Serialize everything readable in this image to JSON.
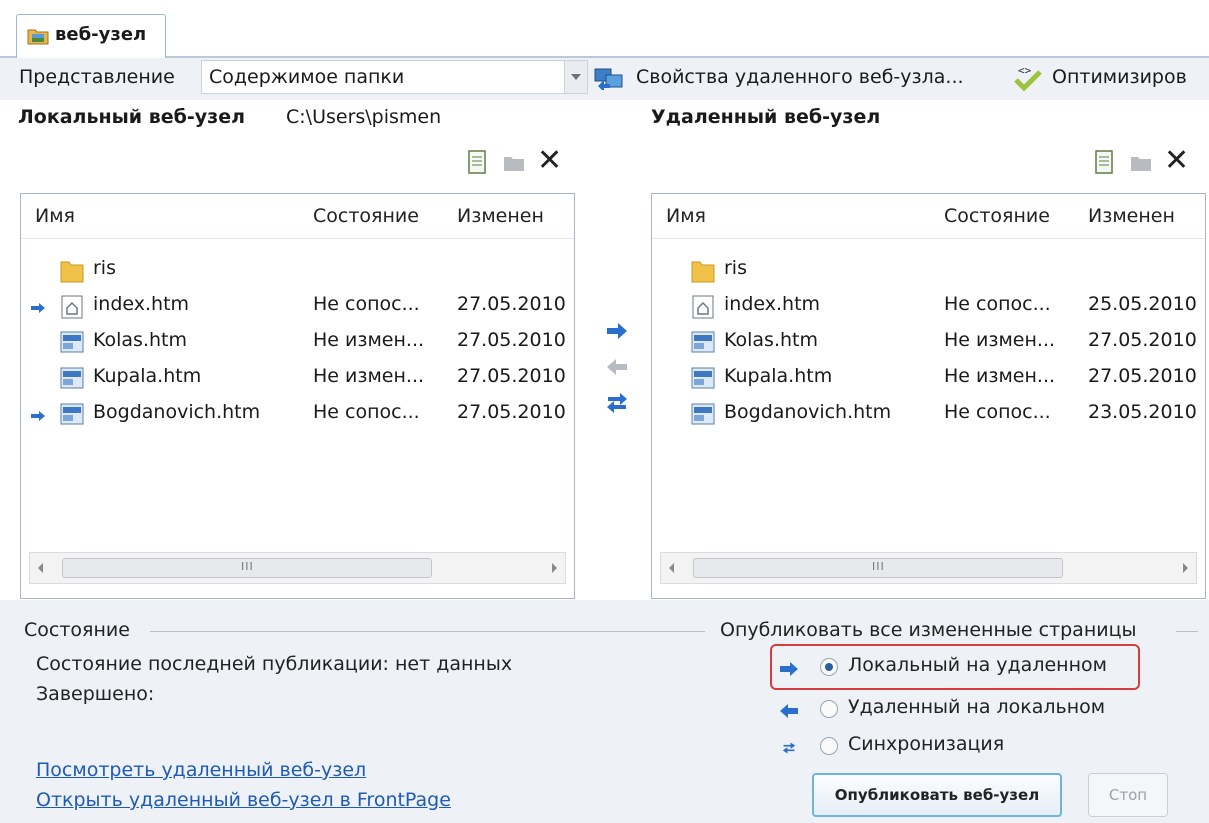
{
  "tab": {
    "label": "веб-узел",
    "icon": "site-folder-icon"
  },
  "toolbar": {
    "view_label": "Представление",
    "view_value": "Содержимое папки",
    "remote_props_label": "Свойства удаленного веб-узла...",
    "optimize_label": "Оптимизиров"
  },
  "local": {
    "title": "Локальный веб-узел",
    "path": "C:\\Users\\pismen",
    "columns": [
      "Имя",
      "Состояние",
      "Изменен"
    ],
    "files": [
      {
        "name": "ris",
        "state": "",
        "date": "",
        "icon": "folder-icon",
        "arrow": false
      },
      {
        "name": "index.htm",
        "state": "Не сопос...",
        "date": "27.05.2010",
        "icon": "home-page-icon",
        "arrow": true
      },
      {
        "name": "Kolas.htm",
        "state": "Не измен...",
        "date": "27.05.2010",
        "icon": "web-page-icon",
        "arrow": false
      },
      {
        "name": "Kupala.htm",
        "state": "Не измен...",
        "date": "27.05.2010",
        "icon": "web-page-icon",
        "arrow": false
      },
      {
        "name": "Bogdanovich.htm",
        "state": "Не сопос...",
        "date": "27.05.2010",
        "icon": "web-page-icon",
        "arrow": true
      }
    ]
  },
  "remote": {
    "title": "Удаленный веб-узел",
    "columns": [
      "Имя",
      "Состояние",
      "Изменен"
    ],
    "files": [
      {
        "name": "ris",
        "state": "",
        "date": "",
        "icon": "folder-icon"
      },
      {
        "name": "index.htm",
        "state": "Не сопос...",
        "date": "25.05.2010",
        "icon": "home-page-icon"
      },
      {
        "name": "Kolas.htm",
        "state": "Не измен...",
        "date": "27.05.2010",
        "icon": "web-page-icon"
      },
      {
        "name": "Kupala.htm",
        "state": "Не измен...",
        "date": "27.05.2010",
        "icon": "web-page-icon"
      },
      {
        "name": "Bogdanovich.htm",
        "state": "Не сопос...",
        "date": "23.05.2010",
        "icon": "web-page-icon"
      }
    ]
  },
  "status": {
    "section_label": "Состояние",
    "last_publish": "Состояние последней публикации: нет данных",
    "done": "Завершено:",
    "link_view": "Посмотреть удаленный веб-узел",
    "link_open": "Открыть удаленный веб-узел в FrontPage"
  },
  "publish": {
    "section_label": "Опубликовать все измененные страницы",
    "options": [
      {
        "label": "Локальный на удаленном",
        "checked": true,
        "icon": "arrow-right-icon"
      },
      {
        "label": "Удаленный на локальном",
        "checked": false,
        "icon": "arrow-left-icon"
      },
      {
        "label": "Синхронизация",
        "checked": false,
        "icon": "sync-arrows-icon"
      }
    ],
    "publish_button": "Опубликовать веб-узел",
    "stop_button": "Стоп"
  },
  "colors": {
    "accent": "#2a6fd0",
    "highlight_border": "#d83c3c",
    "link": "#1e5bb8"
  }
}
